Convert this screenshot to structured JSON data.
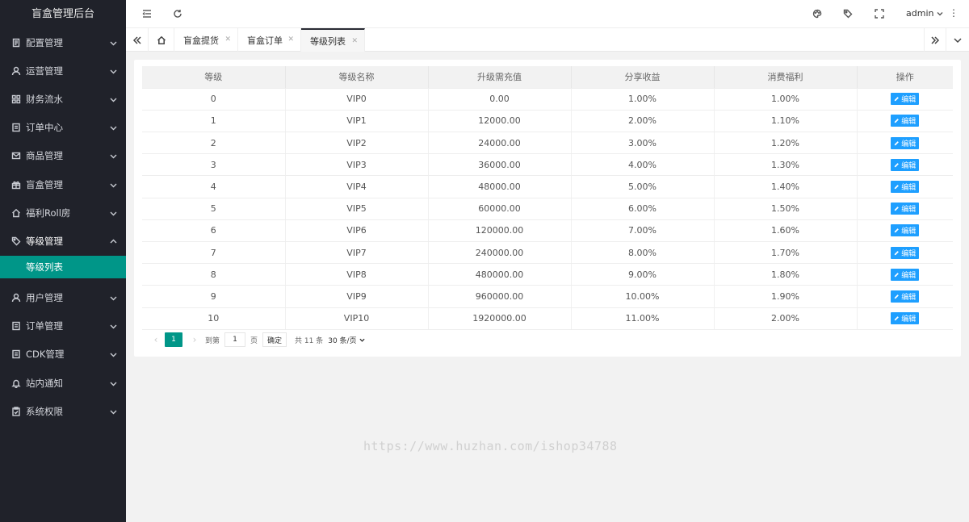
{
  "app_title": "盲盒管理后台",
  "sidebar": {
    "items": [
      {
        "label": "配置管理",
        "icon": "settings-doc-icon"
      },
      {
        "label": "运营管理",
        "icon": "user-icon"
      },
      {
        "label": "财务流水",
        "icon": "grid-icon"
      },
      {
        "label": "订单中心",
        "icon": "document-icon"
      },
      {
        "label": "商品管理",
        "icon": "mail-icon"
      },
      {
        "label": "盲盒管理",
        "icon": "gift-icon"
      },
      {
        "label": "福利Roll房",
        "icon": "home-icon"
      },
      {
        "label": "等级管理",
        "icon": "tag-icon"
      },
      {
        "label": "用户管理",
        "icon": "user-icon"
      },
      {
        "label": "订单管理",
        "icon": "document-icon"
      },
      {
        "label": "CDK管理",
        "icon": "document-icon"
      },
      {
        "label": "站内通知",
        "icon": "bell-icon"
      },
      {
        "label": "系统权限",
        "icon": "clipboard-check-icon"
      }
    ],
    "active_sub": "等级列表"
  },
  "header": {
    "user": "admin"
  },
  "tabs": [
    {
      "label": "盲盒提货"
    },
    {
      "label": "盲盒订单"
    },
    {
      "label": "等级列表"
    }
  ],
  "table": {
    "headers": [
      "等级",
      "等级名称",
      "升级需充值",
      "分享收益",
      "消费福利",
      "操作"
    ],
    "edit_label": "编辑",
    "rows": [
      [
        "0",
        "VIP0",
        "0.00",
        "1.00%",
        "1.00%"
      ],
      [
        "1",
        "VIP1",
        "12000.00",
        "2.00%",
        "1.10%"
      ],
      [
        "2",
        "VIP2",
        "24000.00",
        "3.00%",
        "1.20%"
      ],
      [
        "3",
        "VIP3",
        "36000.00",
        "4.00%",
        "1.30%"
      ],
      [
        "4",
        "VIP4",
        "48000.00",
        "5.00%",
        "1.40%"
      ],
      [
        "5",
        "VIP5",
        "60000.00",
        "6.00%",
        "1.50%"
      ],
      [
        "6",
        "VIP6",
        "120000.00",
        "7.00%",
        "1.60%"
      ],
      [
        "7",
        "VIP7",
        "240000.00",
        "8.00%",
        "1.70%"
      ],
      [
        "8",
        "VIP8",
        "480000.00",
        "9.00%",
        "1.80%"
      ],
      [
        "9",
        "VIP9",
        "960000.00",
        "10.00%",
        "1.90%"
      ],
      [
        "10",
        "VIP10",
        "1920000.00",
        "11.00%",
        "2.00%"
      ]
    ]
  },
  "pager": {
    "current": "1",
    "goto_label": "到第",
    "goto_value": "1",
    "page_unit": "页",
    "confirm": "确定",
    "total": "共 11 条",
    "page_size": "30 条/页"
  },
  "watermark": "https://www.huzhan.com/ishop34788"
}
